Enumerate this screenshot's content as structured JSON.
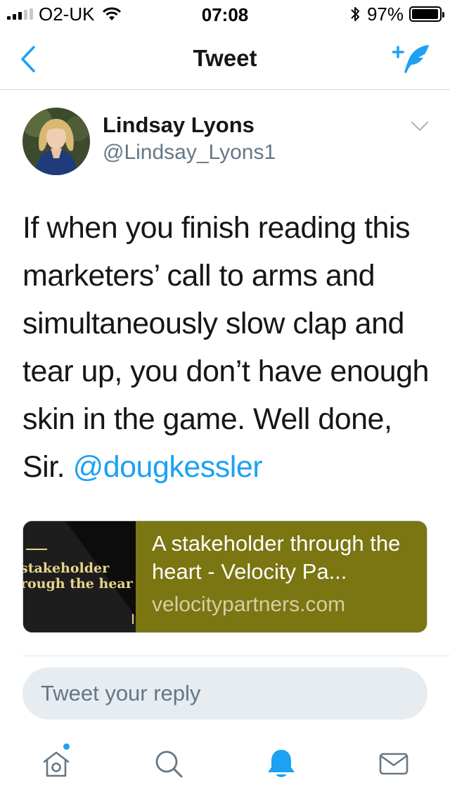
{
  "status_bar": {
    "carrier": "O2-UK",
    "time": "07:08",
    "battery": "97%",
    "battery_level": 0.97,
    "icons": [
      "signal-icon",
      "wifi-icon",
      "bluetooth-icon",
      "battery-icon"
    ]
  },
  "nav": {
    "title": "Tweet",
    "back_icon": "chevron-left-icon",
    "compose_icon": "compose-tweet-icon"
  },
  "tweet": {
    "author_name": "Lindsay Lyons",
    "author_handle": "@Lindsay_Lyons1",
    "text": "If when you finish reading this marketers’ call to arms and simultaneously slow clap and tear up, you don’t have enough skin in the game. Well done, Sir. ",
    "mention": "@dougkessler",
    "more_icon": "chevron-down-icon"
  },
  "link_card": {
    "thumb_line1": "stakeholder",
    "thumb_line2": "rough the hear",
    "title": "A stakeholder through the heart - Velocity Pa...",
    "domain": "velocitypartners.com"
  },
  "reply": {
    "placeholder": "Tweet your reply"
  },
  "tab_bar": {
    "items": [
      {
        "name": "home",
        "icon": "home-icon"
      },
      {
        "name": "search",
        "icon": "search-icon"
      },
      {
        "name": "notifications",
        "icon": "bell-icon"
      },
      {
        "name": "messages",
        "icon": "envelope-icon"
      }
    ]
  },
  "colors": {
    "accent": "#1da1f2",
    "card_background": "#7b7512",
    "text": "#14171a",
    "secondary_text": "#657786"
  }
}
